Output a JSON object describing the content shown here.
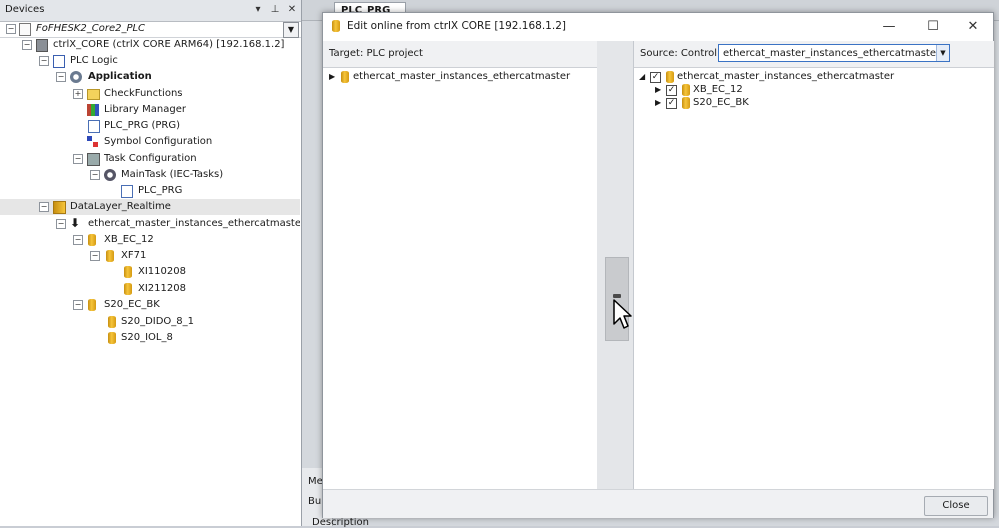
{
  "devices": {
    "title": "Devices",
    "pin": "▾",
    "dock": "⊥",
    "close": "✕",
    "tree": [
      {
        "label": "FoFHESK2_Core2_PLC",
        "italic": true,
        "bold": false
      },
      {
        "label": "ctrlX_CORE (ctrlX CORE ARM64) [192.168.1.2]"
      },
      {
        "label": "PLC Logic"
      },
      {
        "label": "Application",
        "bold": true
      },
      {
        "label": "CheckFunctions"
      },
      {
        "label": "Library Manager"
      },
      {
        "label": "PLC_PRG (PRG)"
      },
      {
        "label": "Symbol Configuration"
      },
      {
        "label": "Task Configuration"
      },
      {
        "label": "MainTask (IEC-Tasks)"
      },
      {
        "label": "PLC_PRG"
      },
      {
        "label": "DataLayer_Realtime"
      },
      {
        "label": "ethercat_master_instances_ethercatmaster (DataLa"
      },
      {
        "label": "XB_EC_12"
      },
      {
        "label": "XF71"
      },
      {
        "label": "XI110208"
      },
      {
        "label": "XI211208"
      },
      {
        "label": "S20_EC_BK"
      },
      {
        "label": "S20_DIDO_8_1"
      },
      {
        "label": "S20_IOL_8"
      }
    ]
  },
  "editor": {
    "tab_label": "PLC_PRG",
    "tab_close": "x",
    "bottom_tab": "Me",
    "bottom_btn": "Bu",
    "bottom_desc": "Description"
  },
  "dialog": {
    "title": "Edit online from ctrlX CORE [192.168.1.2]",
    "minimize": "—",
    "maximize": "☐",
    "close": "✕",
    "left_header": "Target: PLC project",
    "left_tree": [
      {
        "label": "ethercat_master_instances_ethercatmaster"
      }
    ],
    "right_header_label": "Source: Control",
    "source_value": "ethercat_master_instances_ethercatmaster",
    "right_tree": [
      {
        "label": "ethercat_master_instances_ethercatmaster",
        "checked": true
      },
      {
        "label": "XB_EC_12",
        "checked": true
      },
      {
        "label": "S20_EC_BK",
        "checked": true
      }
    ],
    "close_button": "Close"
  }
}
